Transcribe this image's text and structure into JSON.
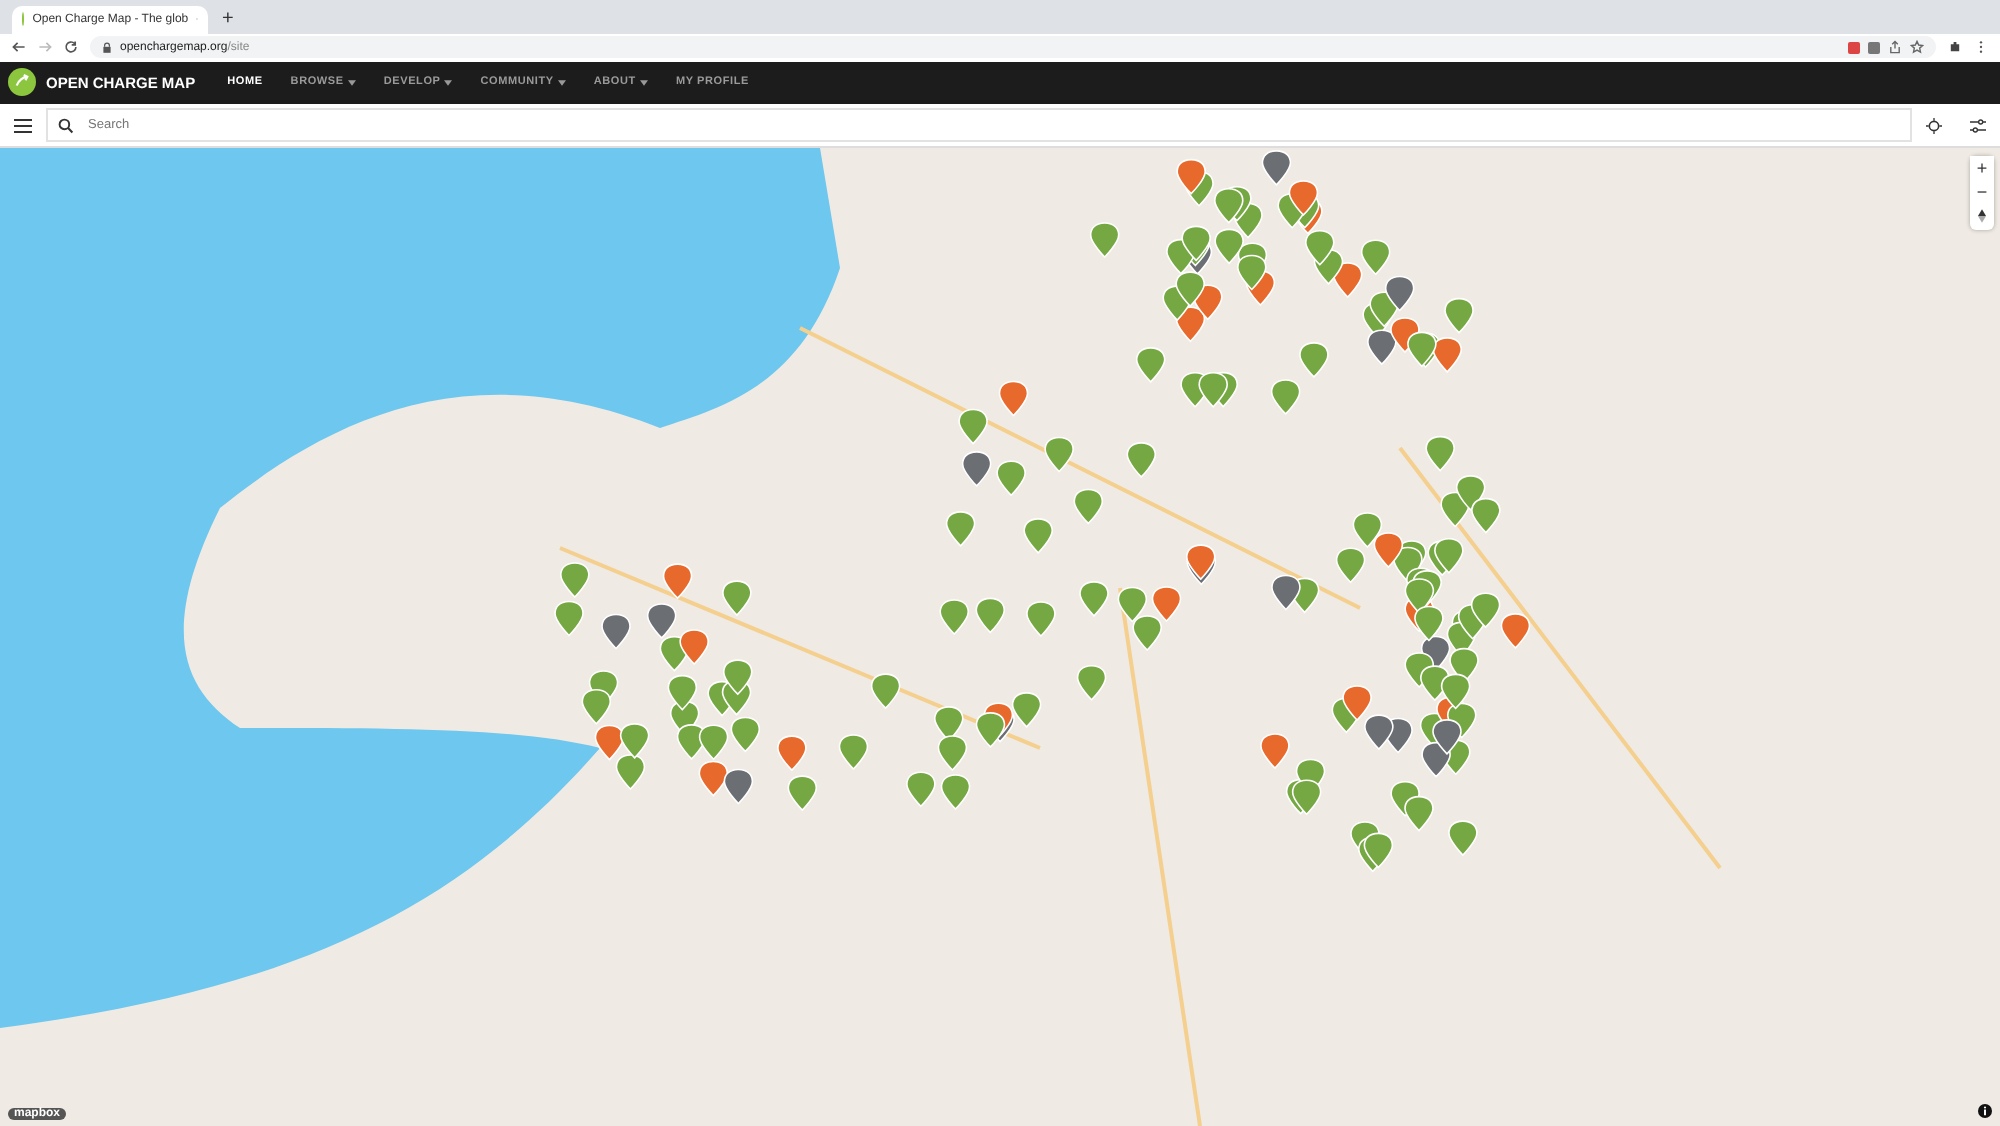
{
  "browser": {
    "tab_title": "Open Charge Map - The glob",
    "new_tab": "+",
    "url_domain": "openchargemap.org",
    "url_path": "/site"
  },
  "navbar": {
    "brand": "OPEN CHARGE MAP",
    "items": [
      {
        "label": "HOME",
        "selected": true,
        "dropdown": false
      },
      {
        "label": "BROWSE",
        "selected": false,
        "dropdown": true
      },
      {
        "label": "DEVELOP",
        "selected": false,
        "dropdown": true
      },
      {
        "label": "COMMUNITY",
        "selected": false,
        "dropdown": true
      },
      {
        "label": "ABOUT",
        "selected": false,
        "dropdown": true
      },
      {
        "label": "MY PROFILE",
        "selected": false,
        "dropdown": false
      }
    ]
  },
  "search": {
    "placeholder": "Search"
  },
  "map": {
    "zoom_in": "+",
    "zoom_out": "−",
    "attribution": "mapbox"
  }
}
